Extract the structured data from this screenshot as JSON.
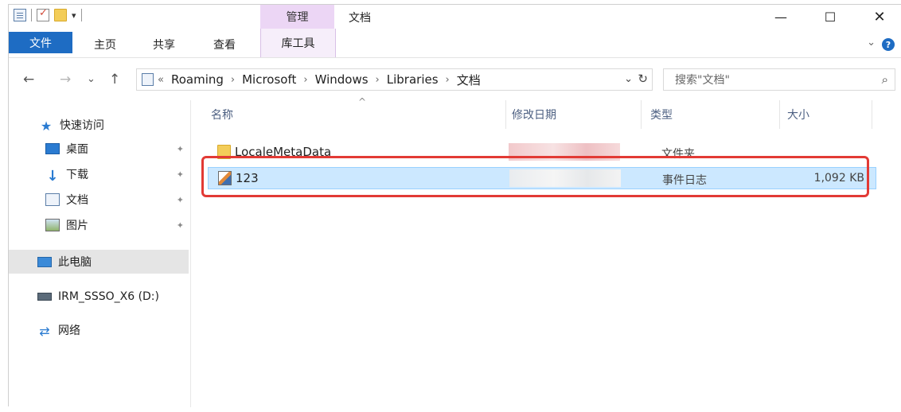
{
  "window": {
    "title": "文档",
    "context_tab": "管理",
    "controls": {
      "minimize": "—",
      "maximize": "☐",
      "close": "✕"
    }
  },
  "ribbon": {
    "tabs": [
      "文件",
      "主页",
      "共享",
      "查看",
      "库工具"
    ],
    "help": "?",
    "chevron": "⌄"
  },
  "navigation": {
    "back": "←",
    "forward": "→",
    "recent": "⌄",
    "up": "↑",
    "breadcrumb_prefix": "«",
    "breadcrumb": [
      "Roaming",
      "Microsoft",
      "Windows",
      "Libraries",
      "文档"
    ],
    "search_placeholder": "搜索\"文档\""
  },
  "sidebar": {
    "quick_access": "快速访问",
    "items": [
      {
        "label": "桌面",
        "pinned": true
      },
      {
        "label": "下载",
        "pinned": true
      },
      {
        "label": "文档",
        "pinned": true
      },
      {
        "label": "图片",
        "pinned": true
      }
    ],
    "this_pc": "此电脑",
    "drive": "IRM_SSSO_X6 (D:)",
    "network": "网络"
  },
  "file_list": {
    "columns": [
      "名称",
      "修改日期",
      "类型",
      "大小"
    ],
    "rows": [
      {
        "name": "LocaleMetaData",
        "type": "文件夹",
        "size": ""
      },
      {
        "name": "123",
        "type": "事件日志",
        "size": "1,092 KB"
      }
    ]
  },
  "colors": {
    "file_tab": "#1e6cc3",
    "context_tab": "#ecd6f5",
    "highlight": "#e23a35",
    "selection": "#cce8ff"
  }
}
